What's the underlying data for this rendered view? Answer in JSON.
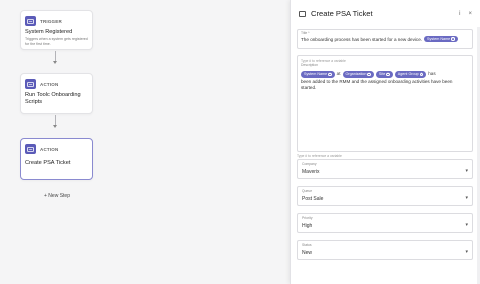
{
  "canvas": {
    "nodes": [
      {
        "type": "TRIGGER",
        "title": "System Registered",
        "description": "Triggers when a system gets registered for the first time."
      },
      {
        "type": "ACTION",
        "title": "Run Toolc Onboarding Scripts",
        "description": ""
      },
      {
        "type": "ACTION",
        "title": "Create PSA Ticket",
        "description": ""
      }
    ],
    "new_step_label": "+ New Step"
  },
  "panel": {
    "title": "Create PSA Ticket",
    "tools": {
      "info": "i",
      "close": "×"
    },
    "title_field": {
      "label": "Title *",
      "text": "The onboarding process has been started for a new device.",
      "chip": "System Name"
    },
    "description_field": {
      "hint": "Type # to reference a variable",
      "label": "Description",
      "chips": [
        "System Name",
        "Organization",
        "Site",
        "Agent Group"
      ],
      "separator": "at",
      "tail_word": "has",
      "text": "been added to the RMM and the assigned onboarding activities have been started."
    },
    "company_field": {
      "hint": "Type # to reference a variable",
      "label": "Company",
      "value": "Maverix"
    },
    "queue_field": {
      "label": "Queue",
      "value": "Post Sale"
    },
    "priority_field": {
      "label": "Priority",
      "value": "High"
    },
    "status_field": {
      "label": "Status",
      "value": "New"
    },
    "accent_color": "#6a6ac2"
  }
}
